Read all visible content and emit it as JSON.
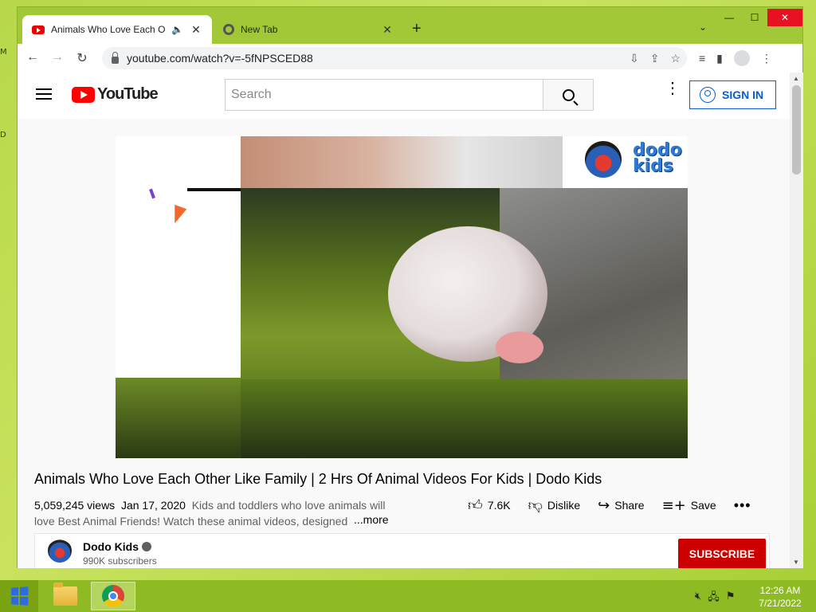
{
  "browser": {
    "tabs": [
      {
        "title": "Animals Who Love Each Other Like Family",
        "active": true
      },
      {
        "title": "New Tab",
        "active": false
      }
    ],
    "url": "youtube.com/watch?v=-5fNPSCED88"
  },
  "youtube": {
    "logo_text": "YouTube",
    "search_placeholder": "Search",
    "sign_in_label": "SIGN IN",
    "video": {
      "overlay_brand_top": "dodo",
      "overlay_brand_bottom": "kids"
    },
    "title": "Animals Who Love Each Other Like Family | 2 Hrs Of Animal Videos For Kids | Dodo Kids",
    "views": "5,059,245 views",
    "date": "Jan 17, 2020",
    "description": "Kids and toddlers who love animals will love Best Animal Friends! Watch these animal videos, designed",
    "more_label": "...more",
    "likes": "7.6K",
    "dislike_label": "Dislike",
    "share_label": "Share",
    "save_label": "Save",
    "channel": {
      "name": "Dodo Kids",
      "subscribers": "990K subscribers",
      "subscribe_label": "SUBSCRIBE"
    }
  },
  "taskbar": {
    "time": "12:26 AM",
    "date": "7/21/2022"
  },
  "colors": {
    "desktop": "#b7d84a",
    "youtube_red": "#ff0000",
    "subscribe_red": "#cc0000",
    "sign_in_blue": "#065fd4"
  }
}
